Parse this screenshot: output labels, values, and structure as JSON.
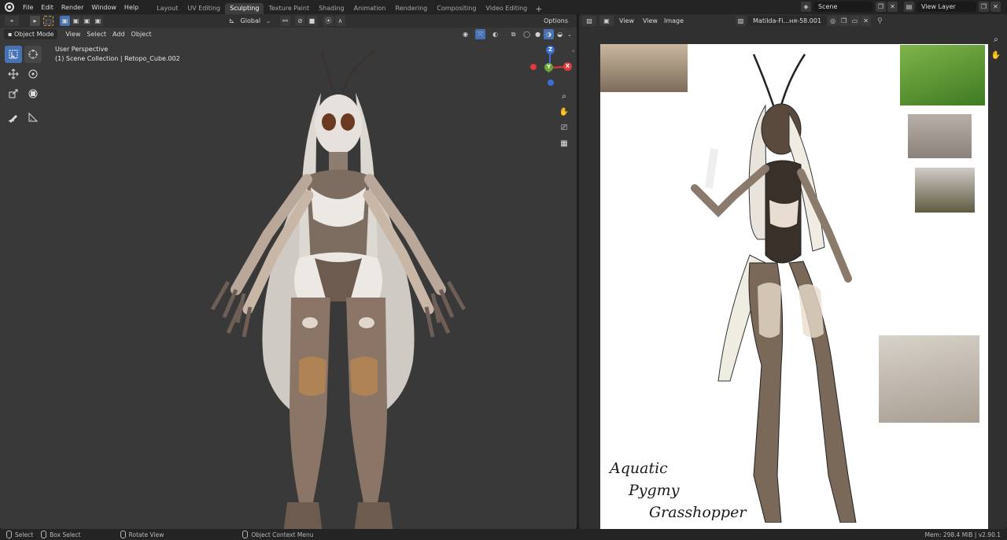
{
  "top_menu": [
    "File",
    "Edit",
    "Render",
    "Window",
    "Help"
  ],
  "workspace_tabs": [
    {
      "label": "Layout",
      "active": false
    },
    {
      "label": "UV Editing",
      "active": false
    },
    {
      "label": "Sculpting",
      "active": true
    },
    {
      "label": "Texture Paint",
      "active": false
    },
    {
      "label": "Shading",
      "active": false
    },
    {
      "label": "Animation",
      "active": false
    },
    {
      "label": "Rendering",
      "active": false
    },
    {
      "label": "Compositing",
      "active": false
    },
    {
      "label": "Video Editing",
      "active": false
    }
  ],
  "scene": {
    "label": "Scene",
    "view_layer": "View Layer"
  },
  "viewport": {
    "tool_header": {
      "orientation": "Global",
      "options": "Options"
    },
    "mode": "Object Mode",
    "menus": [
      "View",
      "Select",
      "Add",
      "Object"
    ],
    "perspective": "User Perspective",
    "collection": "(1) Scene Collection | Retopo_Cube.002",
    "gizmo": {
      "z": "Z",
      "y": "Y",
      "x": "X"
    }
  },
  "image_editor": {
    "menus": [
      "View",
      "Image"
    ],
    "view_dropdown": "View",
    "image_name": "Matilda-Fi...ня-58.001",
    "caption": [
      "Aquatic",
      "Pygmy",
      "Grasshopper"
    ]
  },
  "status_bar": {
    "select": "Select",
    "box_select": "Box Select",
    "rotate": "Rotate View",
    "context": "Object Context Menu",
    "memory": "Mem: 298.4 MiB | v2.90.1"
  },
  "icons": {
    "logo": "blender-logo-icon",
    "select_tool": "select-box-icon",
    "cursor": "cursor-icon",
    "move": "move-icon",
    "rotate": "rotate-icon",
    "scale": "scale-icon",
    "transform": "transform-icon",
    "annotate": "annotate-icon",
    "measure": "measure-icon"
  },
  "colors": {
    "accent": "#4772b3",
    "axis_x": "#e03a3a",
    "axis_y": "#6ba33a",
    "axis_z": "#3a6fd4"
  }
}
